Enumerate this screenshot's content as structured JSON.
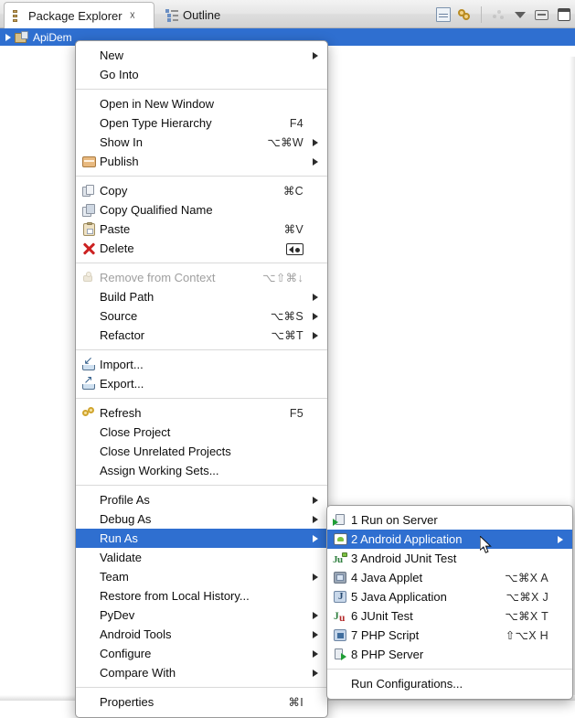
{
  "window": {
    "tabs": [
      {
        "label": "Package Explorer",
        "icon": "package-explorer-icon",
        "active": true,
        "closeable": true
      },
      {
        "label": "Outline",
        "icon": "outline-icon",
        "active": false,
        "closeable": false
      }
    ],
    "toolbar": [
      {
        "name": "collapse-all-button",
        "icon": "collapse-all-icon"
      },
      {
        "name": "link-with-editor-button",
        "icon": "link-editor-icon"
      },
      {
        "name": "view-menu-dots-button",
        "icon": "dots-icon"
      },
      {
        "name": "view-menu-button",
        "icon": "triangle-down-icon"
      },
      {
        "name": "minimize-button",
        "icon": "minimize-icon"
      },
      {
        "name": "maximize-button",
        "icon": "maximize-icon"
      }
    ]
  },
  "tree": {
    "selected_item": {
      "label": "ApiDem",
      "icon": "java-project-icon",
      "expander": "collapsed-arrow-icon"
    }
  },
  "context_menu": {
    "groups": [
      {
        "items": [
          {
            "label": "New",
            "shortcut": "",
            "submenu": true,
            "icon": "",
            "disabled": false,
            "selected": false
          },
          {
            "label": "Go Into",
            "shortcut": "",
            "submenu": false,
            "icon": "",
            "disabled": false,
            "selected": false
          }
        ]
      },
      {
        "items": [
          {
            "label": "Open in New Window",
            "shortcut": "",
            "submenu": false,
            "icon": "",
            "disabled": false,
            "selected": false
          },
          {
            "label": "Open Type Hierarchy",
            "shortcut": "F4",
            "submenu": false,
            "icon": "",
            "disabled": false,
            "selected": false
          },
          {
            "label": "Show In",
            "shortcut": "⌥⌘W",
            "submenu": true,
            "icon": "",
            "disabled": false,
            "selected": false
          },
          {
            "label": "Publish",
            "shortcut": "",
            "submenu": true,
            "icon": "publish-icon",
            "disabled": false,
            "selected": false
          }
        ]
      },
      {
        "items": [
          {
            "label": "Copy",
            "shortcut": "⌘C",
            "submenu": false,
            "icon": "copy-icon",
            "disabled": false,
            "selected": false
          },
          {
            "label": "Copy Qualified Name",
            "shortcut": "",
            "submenu": false,
            "icon": "copy-qualified-name-icon",
            "disabled": false,
            "selected": false
          },
          {
            "label": "Paste",
            "shortcut": "⌘V",
            "submenu": false,
            "icon": "paste-icon",
            "disabled": false,
            "selected": false
          },
          {
            "label": "Delete",
            "shortcut": "DELETE_KEY",
            "submenu": false,
            "icon": "delete-icon",
            "disabled": false,
            "selected": false
          }
        ]
      },
      {
        "items": [
          {
            "label": "Remove from Context",
            "shortcut": "⌥⇧⌘↓",
            "submenu": false,
            "icon": "remove-from-context-icon",
            "disabled": true,
            "selected": false
          },
          {
            "label": "Build Path",
            "shortcut": "",
            "submenu": true,
            "icon": "",
            "disabled": false,
            "selected": false
          },
          {
            "label": "Source",
            "shortcut": "⌥⌘S",
            "submenu": true,
            "icon": "",
            "disabled": false,
            "selected": false
          },
          {
            "label": "Refactor",
            "shortcut": "⌥⌘T",
            "submenu": true,
            "icon": "",
            "disabled": false,
            "selected": false
          }
        ]
      },
      {
        "items": [
          {
            "label": "Import...",
            "shortcut": "",
            "submenu": false,
            "icon": "import-icon",
            "disabled": false,
            "selected": false
          },
          {
            "label": "Export...",
            "shortcut": "",
            "submenu": false,
            "icon": "export-icon",
            "disabled": false,
            "selected": false
          }
        ]
      },
      {
        "items": [
          {
            "label": "Refresh",
            "shortcut": "F5",
            "submenu": false,
            "icon": "refresh-icon",
            "disabled": false,
            "selected": false
          },
          {
            "label": "Close Project",
            "shortcut": "",
            "submenu": false,
            "icon": "",
            "disabled": false,
            "selected": false
          },
          {
            "label": "Close Unrelated Projects",
            "shortcut": "",
            "submenu": false,
            "icon": "",
            "disabled": false,
            "selected": false
          },
          {
            "label": "Assign Working Sets...",
            "shortcut": "",
            "submenu": false,
            "icon": "",
            "disabled": false,
            "selected": false
          }
        ]
      },
      {
        "items": [
          {
            "label": "Profile As",
            "shortcut": "",
            "submenu": true,
            "icon": "",
            "disabled": false,
            "selected": false
          },
          {
            "label": "Debug As",
            "shortcut": "",
            "submenu": true,
            "icon": "",
            "disabled": false,
            "selected": false
          },
          {
            "label": "Run As",
            "shortcut": "",
            "submenu": true,
            "icon": "",
            "disabled": false,
            "selected": true
          },
          {
            "label": "Validate",
            "shortcut": "",
            "submenu": false,
            "icon": "",
            "disabled": false,
            "selected": false
          },
          {
            "label": "Team",
            "shortcut": "",
            "submenu": true,
            "icon": "",
            "disabled": false,
            "selected": false
          },
          {
            "label": "Restore from Local History...",
            "shortcut": "",
            "submenu": false,
            "icon": "",
            "disabled": false,
            "selected": false
          },
          {
            "label": "PyDev",
            "shortcut": "",
            "submenu": true,
            "icon": "",
            "disabled": false,
            "selected": false
          },
          {
            "label": "Android Tools",
            "shortcut": "",
            "submenu": true,
            "icon": "",
            "disabled": false,
            "selected": false
          },
          {
            "label": "Configure",
            "shortcut": "",
            "submenu": true,
            "icon": "",
            "disabled": false,
            "selected": false
          },
          {
            "label": "Compare With",
            "shortcut": "",
            "submenu": true,
            "icon": "",
            "disabled": false,
            "selected": false
          }
        ]
      },
      {
        "items": [
          {
            "label": "Properties",
            "shortcut": "⌘I",
            "submenu": false,
            "icon": "",
            "disabled": false,
            "selected": false
          }
        ]
      }
    ]
  },
  "run_as_submenu": {
    "groups": [
      {
        "items": [
          {
            "label": "1 Run on Server",
            "shortcut": "",
            "icon": "run-on-server-icon",
            "selected": false
          },
          {
            "label": "2 Android Application",
            "shortcut": "",
            "icon": "android-application-icon",
            "selected": true
          },
          {
            "label": "3 Android JUnit Test",
            "shortcut": "",
            "icon": "android-junit-icon",
            "selected": false
          },
          {
            "label": "4 Java Applet",
            "shortcut": "⌥⌘X A",
            "icon": "java-applet-icon",
            "selected": false
          },
          {
            "label": "5 Java Application",
            "shortcut": "⌥⌘X J",
            "icon": "java-application-icon",
            "selected": false
          },
          {
            "label": "6 JUnit Test",
            "shortcut": "⌥⌘X T",
            "icon": "junit-test-icon",
            "selected": false
          },
          {
            "label": "7 PHP Script",
            "shortcut": "⇧⌥X H",
            "icon": "php-script-icon",
            "selected": false
          },
          {
            "label": "8 PHP Server",
            "shortcut": "",
            "icon": "php-server-icon",
            "selected": false
          }
        ]
      },
      {
        "items": [
          {
            "label": "Run Configurations...",
            "shortcut": "",
            "icon": "",
            "selected": false
          }
        ]
      }
    ]
  },
  "colors": {
    "selection_blue": "#2f6fd0",
    "menu_background": "#ffffff",
    "menu_border": "#9a9a9a",
    "text": "#0d0d0d",
    "disabled_text": "#9f9f9f"
  }
}
